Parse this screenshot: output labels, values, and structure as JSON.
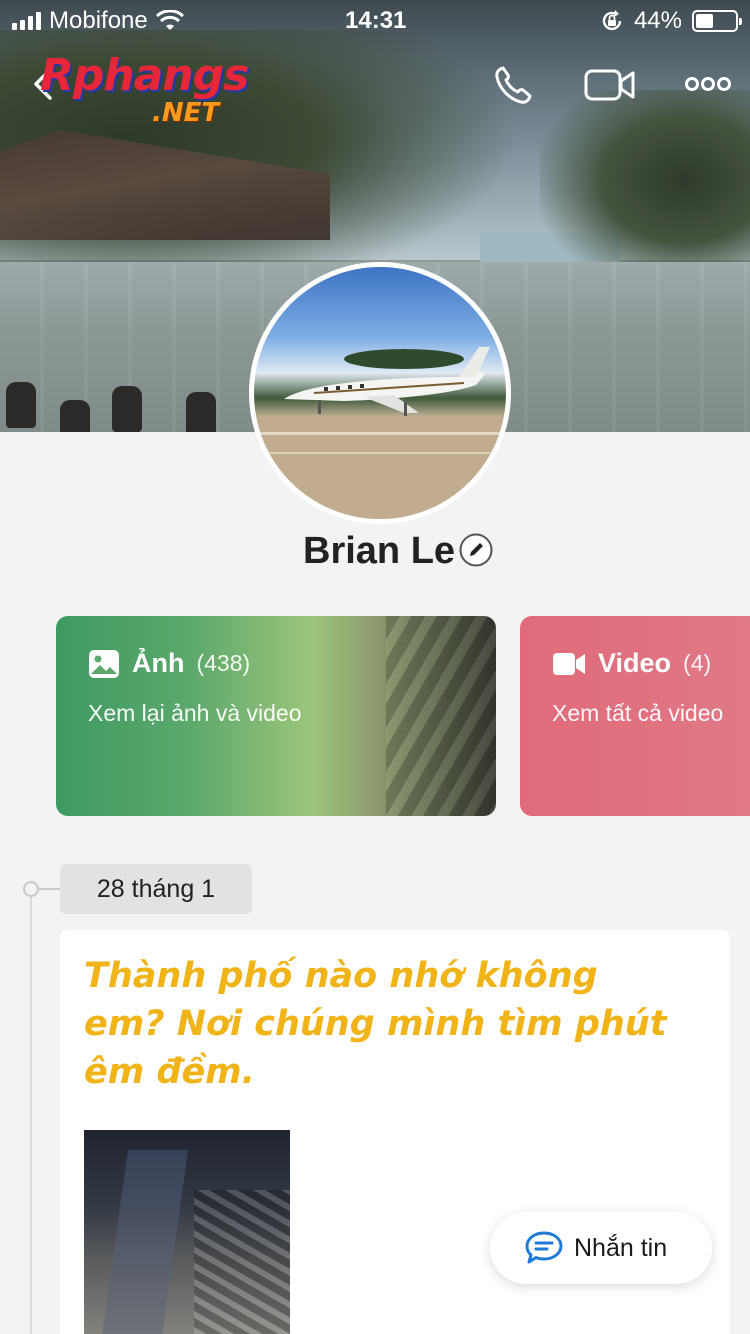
{
  "status_bar": {
    "carrier": "Mobifone",
    "time": "14:31",
    "battery_percent": "44%",
    "battery_level": 0.44,
    "icons": [
      "signal-icon",
      "wifi-icon",
      "rotation-lock-icon",
      "battery-icon"
    ]
  },
  "header": {
    "logo_text_main": "Rphangs",
    "logo_text_sub": ".NET",
    "icons": [
      "back-chevron-icon",
      "phone-icon",
      "video-camera-icon",
      "more-dots-icon"
    ]
  },
  "profile": {
    "name": "Brian Le",
    "edit_icon": "pencil-icon"
  },
  "media_cards": [
    {
      "title": "Ảnh",
      "count": "(438)",
      "subtitle": "Xem lại ảnh và video",
      "icon": "image-icon"
    },
    {
      "title": "Video",
      "count": "(4)",
      "subtitle": "Xem tất cả video",
      "icon": "video-icon"
    }
  ],
  "timeline": {
    "date": "28 tháng 1",
    "post_text": "Thành phố nào nhớ không em? Nơi chúng mình tìm phút êm đềm."
  },
  "message_button": {
    "label": "Nhắn tin",
    "icon": "chat-bubble-icon"
  },
  "colors": {
    "accent_blue": "#1f7ad6",
    "post_text_yellow": "#f0b318",
    "photo_card_green": "#3e9a62",
    "video_card_pink": "#e06a7a"
  }
}
